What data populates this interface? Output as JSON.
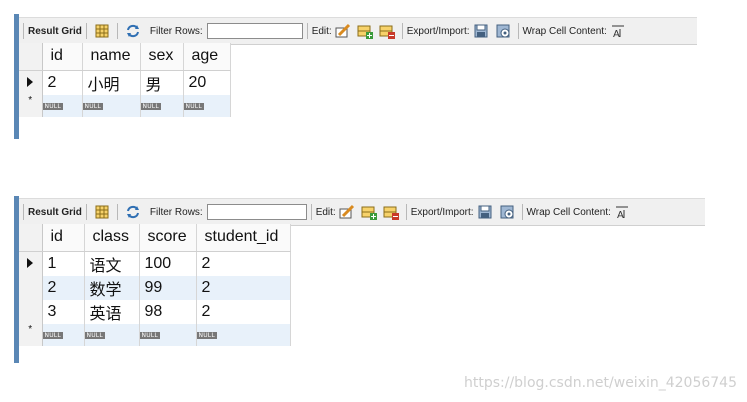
{
  "toolbar": {
    "result_grid": "Result Grid",
    "filter_rows": "Filter Rows:",
    "filter_value": "",
    "edit": "Edit:",
    "export_import": "Export/Import:",
    "wrap_cell": "Wrap Cell Content:"
  },
  "null_label": "NULL",
  "new_row_marker": "*",
  "table1": {
    "columns": [
      "id",
      "name",
      "sex",
      "age"
    ],
    "rows": [
      [
        "2",
        "小明",
        "男",
        "20"
      ]
    ]
  },
  "table2": {
    "columns": [
      "id",
      "class",
      "score",
      "student_id"
    ],
    "rows": [
      [
        "1",
        "语文",
        "100",
        "2"
      ],
      [
        "2",
        "数学",
        "99",
        "2"
      ],
      [
        "3",
        "英语",
        "98",
        "2"
      ]
    ]
  },
  "watermark": "https://blog.csdn.net/weixin_42056745",
  "colors": {
    "accent": "#5a87b5",
    "toolbar_bg": "#f0f0f0",
    "alt_row": "#e8f1fa"
  }
}
